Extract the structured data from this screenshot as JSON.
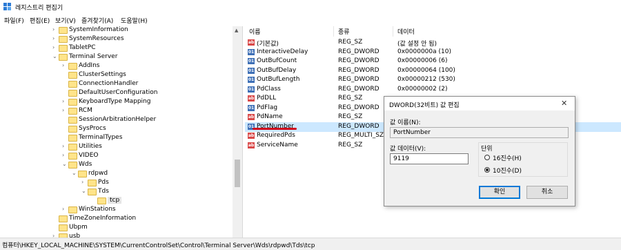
{
  "window": {
    "title": "레지스트리 편집기"
  },
  "menu": [
    "파일(F)",
    "편집(E)",
    "보기(V)",
    "즐겨찾기(A)",
    "도움말(H)"
  ],
  "tree": [
    {
      "label": "SystemInformation",
      "exp": "›"
    },
    {
      "label": "SystemResources",
      "exp": "›"
    },
    {
      "label": "TabletPC",
      "exp": "›"
    },
    {
      "label": "Terminal Server",
      "exp": "⌄"
    },
    {
      "label": "AddIns",
      "exp": "›"
    },
    {
      "label": "ClusterSettings",
      "exp": ""
    },
    {
      "label": "ConnectionHandler",
      "exp": ""
    },
    {
      "label": "DefaultUserConfiguration",
      "exp": ""
    },
    {
      "label": "KeyboardType Mapping",
      "exp": "›"
    },
    {
      "label": "RCM",
      "exp": "›"
    },
    {
      "label": "SessionArbitrationHelper",
      "exp": ""
    },
    {
      "label": "SysProcs",
      "exp": ""
    },
    {
      "label": "TerminalTypes",
      "exp": ""
    },
    {
      "label": "Utilities",
      "exp": "›"
    },
    {
      "label": "VIDEO",
      "exp": "›"
    },
    {
      "label": "Wds",
      "exp": "⌄"
    },
    {
      "label": "rdpwd",
      "exp": "⌄"
    },
    {
      "label": "Pds",
      "exp": "›"
    },
    {
      "label": "Tds",
      "exp": "⌄"
    },
    {
      "label": "tcp",
      "exp": ""
    },
    {
      "label": "WinStations",
      "exp": "›"
    },
    {
      "label": "TimeZoneInformation",
      "exp": ""
    },
    {
      "label": "Ubpm",
      "exp": ""
    },
    {
      "label": "usb",
      "exp": "›"
    }
  ],
  "list": {
    "headers": [
      "이름",
      "종류",
      "데이터"
    ],
    "rows": [
      {
        "name": "(기본값)",
        "type": "REG_SZ",
        "data": "(값 설정 안 됨)",
        "icon": "ab"
      },
      {
        "name": "InteractiveDelay",
        "type": "REG_DWORD",
        "data": "0x0000000a (10)",
        "icon": "01"
      },
      {
        "name": "OutBufCount",
        "type": "REG_DWORD",
        "data": "0x00000006 (6)",
        "icon": "01"
      },
      {
        "name": "OutBufDelay",
        "type": "REG_DWORD",
        "data": "0x00000064 (100)",
        "icon": "01"
      },
      {
        "name": "OutBufLength",
        "type": "REG_DWORD",
        "data": "0x00000212 (530)",
        "icon": "01"
      },
      {
        "name": "PdClass",
        "type": "REG_DWORD",
        "data": "0x00000002 (2)",
        "icon": "01"
      },
      {
        "name": "PdDLL",
        "type": "REG_SZ",
        "data": "",
        "icon": "ab"
      },
      {
        "name": "PdFlag",
        "type": "REG_DWORD",
        "data": "",
        "icon": "01"
      },
      {
        "name": "PdName",
        "type": "REG_SZ",
        "data": "",
        "icon": "ab"
      },
      {
        "name": "PortNumber",
        "type": "REG_DWORD",
        "data": "",
        "icon": "01"
      },
      {
        "name": "RequiredPds",
        "type": "REG_MULTI_SZ",
        "data": "",
        "icon": "ab"
      },
      {
        "name": "ServiceName",
        "type": "REG_SZ",
        "data": "",
        "icon": "ab"
      }
    ]
  },
  "dialog": {
    "title": "DWORD(32비트) 값 편집",
    "close": "✕",
    "name_label": "값 이름(N):",
    "name_value": "PortNumber",
    "data_label": "값 데이터(V):",
    "data_value": "9119",
    "base_label": "단위",
    "hex_label": "16진수(H)",
    "dec_label": "10진수(D)",
    "ok": "확인",
    "cancel": "취소"
  },
  "status": "컴퓨터\\HKEY_LOCAL_MACHINE\\SYSTEM\\CurrentControlSet\\Control\\Terminal Server\\Wds\\rdpwd\\Tds\\tcp"
}
